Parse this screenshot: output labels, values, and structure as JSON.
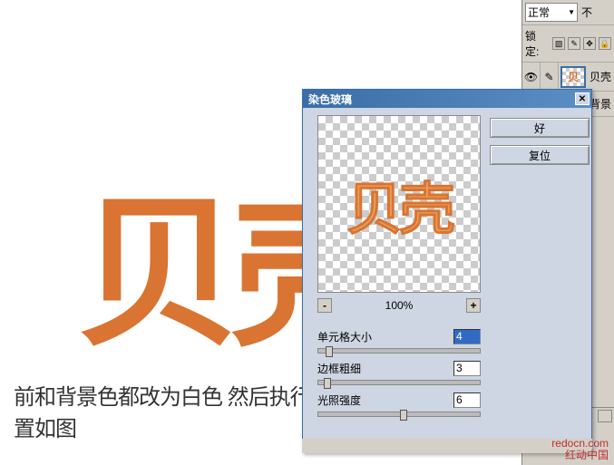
{
  "canvas": {
    "big_text": "贝壳",
    "caption": "前和背景色都改为白色  然后执行滤镜  纹理  染色玻璃  设置如图"
  },
  "layers_panel": {
    "blend_mode": "正常",
    "opacity_label": "不",
    "lock_label": "锁定:",
    "layer1_name": "贝壳",
    "layer2_name": "背景"
  },
  "dialog": {
    "title": "染色玻璃",
    "preview_text": "贝壳",
    "zoom": "100%",
    "zoom_minus": "-",
    "zoom_plus": "+",
    "ok": "好",
    "reset": "复位",
    "params": {
      "cell_size_label": "单元格大小",
      "cell_size_value": "4",
      "border_label": "边框粗细",
      "border_value": "3",
      "light_label": "光照强度",
      "light_value": "6"
    }
  },
  "watermark": "redocn.com\n红动中国"
}
